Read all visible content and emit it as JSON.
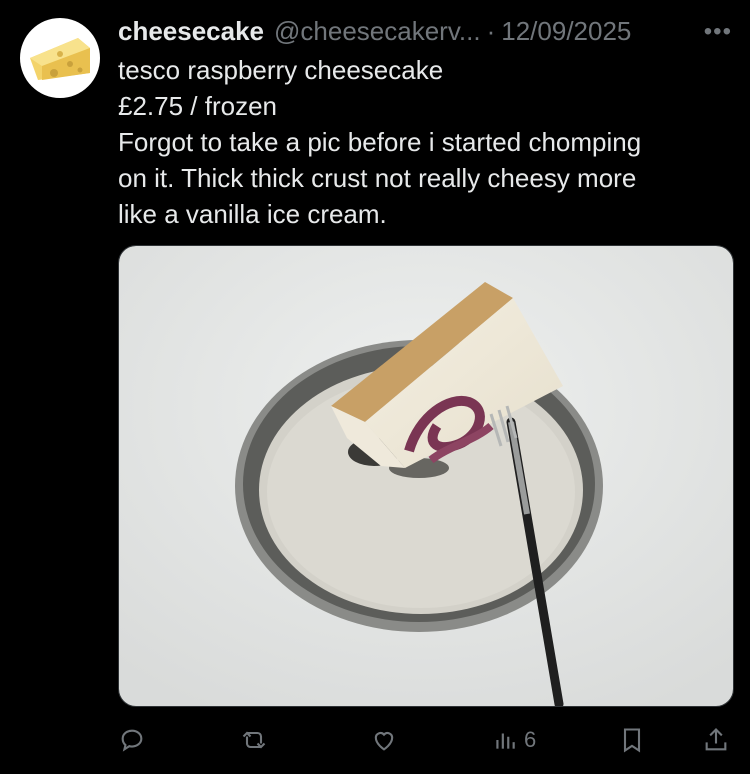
{
  "post": {
    "display_name": "cheesecake",
    "handle": "@cheesecakerv...",
    "separator": "·",
    "date": "12/09/2025",
    "more_label": "•••",
    "lines": [
      "tesco raspberry cheesecake",
      "£2.75 / frozen",
      "Forgot to take a pic before i started chomping",
      "on it. Thick thick crust not really cheesy more",
      "like a vanilla ice cream."
    ]
  },
  "media": {
    "description": "photo"
  },
  "actions": {
    "views_count": "6"
  },
  "colors": {
    "background": "#000000",
    "text": "#e7e9ea",
    "muted": "#71767b"
  }
}
